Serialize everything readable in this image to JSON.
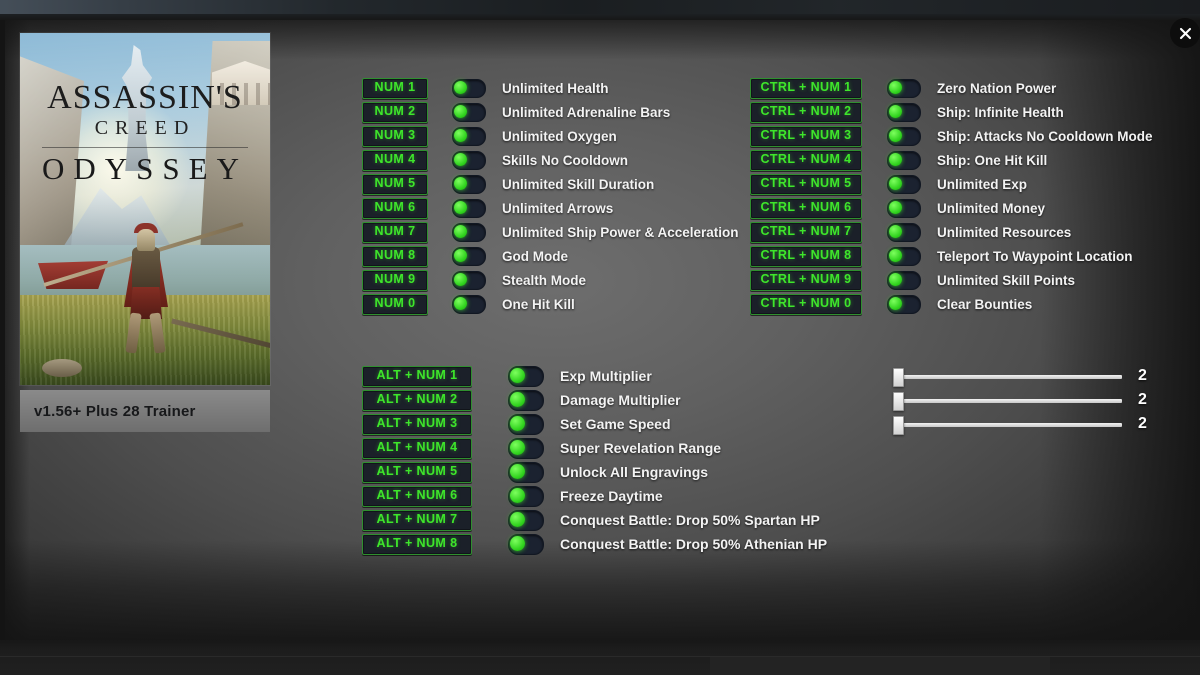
{
  "window": {
    "close_icon": "close-icon"
  },
  "game": {
    "title_line1": "ASSASSIN'S",
    "title_line2": "CREED",
    "title_line3": "ODYSSEY",
    "version_label": "v1.56+ Plus 28 Trainer"
  },
  "colors": {
    "hotkey_text": "#3ee62b",
    "hotkey_border": "#2f8f2f",
    "hotkey_bg": "#1b2029",
    "toggle_knob": "#2ed11c",
    "toggle_bg": "#1b2230",
    "label_text": "#f3f3f3",
    "panel_bg": "#606060"
  },
  "columns": {
    "left": [
      {
        "hotkey": "NUM 1",
        "label": "Unlimited Health",
        "toggle": "on"
      },
      {
        "hotkey": "NUM 2",
        "label": "Unlimited  Adrenaline Bars",
        "toggle": "on"
      },
      {
        "hotkey": "NUM 3",
        "label": "Unlimited  Oxygen",
        "toggle": "on"
      },
      {
        "hotkey": "NUM 4",
        "label": "Skills No Cooldown",
        "toggle": "on"
      },
      {
        "hotkey": "NUM 5",
        "label": "Unlimited Skill Duration",
        "toggle": "on"
      },
      {
        "hotkey": "NUM 6",
        "label": "Unlimited Arrows",
        "toggle": "on"
      },
      {
        "hotkey": "NUM 7",
        "label": "Unlimited Ship Power & Acceleration",
        "toggle": "on"
      },
      {
        "hotkey": "NUM 8",
        "label": "God Mode",
        "toggle": "on"
      },
      {
        "hotkey": "NUM 9",
        "label": "Stealth Mode",
        "toggle": "on"
      },
      {
        "hotkey": "NUM 0",
        "label": "One Hit Kill",
        "toggle": "on"
      }
    ],
    "right": [
      {
        "hotkey": "CTRL + NUM 1",
        "label": "Zero Nation Power",
        "toggle": "on"
      },
      {
        "hotkey": "CTRL + NUM 2",
        "label": "Ship: Infinite Health",
        "toggle": "on"
      },
      {
        "hotkey": "CTRL + NUM 3",
        "label": "Ship: Attacks No Cooldown Mode",
        "toggle": "on"
      },
      {
        "hotkey": "CTRL + NUM 4",
        "label": "Ship: One Hit Kill",
        "toggle": "on"
      },
      {
        "hotkey": "CTRL + NUM 5",
        "label": "Unlimited Exp",
        "toggle": "on"
      },
      {
        "hotkey": "CTRL + NUM 6",
        "label": "Unlimited Money",
        "toggle": "on"
      },
      {
        "hotkey": "CTRL + NUM 7",
        "label": "Unlimited Resources",
        "toggle": "on"
      },
      {
        "hotkey": "CTRL + NUM 8",
        "label": "Teleport To Waypoint Location",
        "toggle": "on"
      },
      {
        "hotkey": "CTRL + NUM 9",
        "label": "Unlimited Skill Points",
        "toggle": "on"
      },
      {
        "hotkey": "CTRL + NUM 0",
        "label": "Clear Bounties",
        "toggle": "on"
      }
    ],
    "bottom": [
      {
        "hotkey": "ALT + NUM 1",
        "label": "Exp Multiplier",
        "toggle": "on",
        "slider": true,
        "value": "2"
      },
      {
        "hotkey": "ALT + NUM 2",
        "label": "Damage Multiplier",
        "toggle": "on",
        "slider": true,
        "value": "2"
      },
      {
        "hotkey": "ALT + NUM 3",
        "label": "Set Game Speed",
        "toggle": "on",
        "slider": true,
        "value": "2"
      },
      {
        "hotkey": "ALT + NUM 4",
        "label": "Super Revelation Range",
        "toggle": "on",
        "slider": false
      },
      {
        "hotkey": "ALT + NUM 5",
        "label": "Unlock All Engravings",
        "toggle": "on",
        "slider": false
      },
      {
        "hotkey": "ALT + NUM 6",
        "label": "Freeze Daytime",
        "toggle": "on",
        "slider": false
      },
      {
        "hotkey": "ALT + NUM 7",
        "label": "Conquest Battle: Drop 50% Spartan HP",
        "toggle": "on",
        "slider": false
      },
      {
        "hotkey": "ALT + NUM 8",
        "label": "Conquest Battle: Drop 50% Athenian HP",
        "toggle": "on",
        "slider": false
      }
    ]
  }
}
